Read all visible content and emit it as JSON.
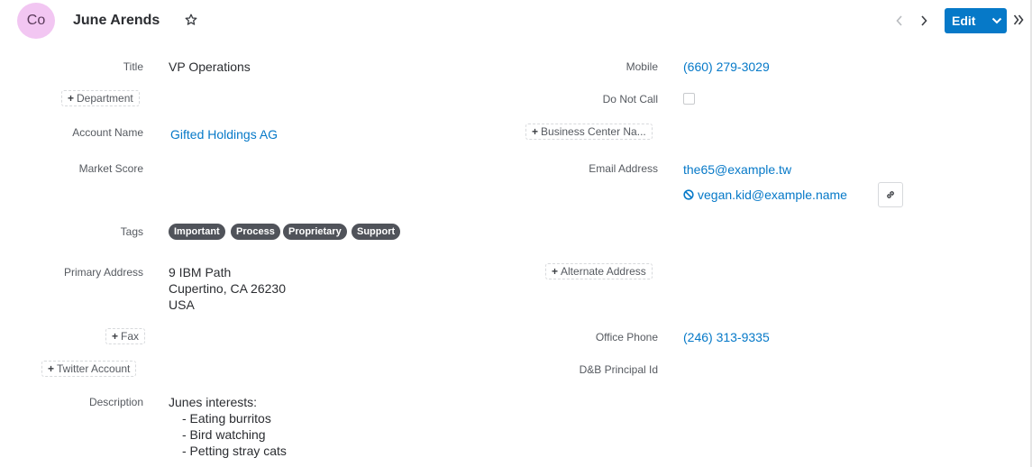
{
  "header": {
    "avatar_initials": "Co",
    "avatar_color": "#f2c6f2",
    "record_name": "June Arends",
    "edit_label": "Edit",
    "accent": "#0679c8",
    "icons": [
      "star-icon",
      "chevron-left-icon",
      "chevron-right-icon",
      "chevron-down-icon",
      "double-chevron-right-icon"
    ]
  },
  "fields": {
    "title": {
      "label": "Title",
      "value": "VP Operations"
    },
    "department": {
      "add_label": "Department"
    },
    "account_name": {
      "label": "Account Name",
      "value": "Gifted Holdings AG"
    },
    "market_score": {
      "label": "Market Score",
      "value": ""
    },
    "tags": {
      "label": "Tags",
      "items": [
        "Important",
        "Process",
        "Proprietary",
        "Support"
      ]
    },
    "primary_address": {
      "label": "Primary Address",
      "line1": "9 IBM Path",
      "line2": "Cupertino, CA 26230",
      "line3": "USA"
    },
    "fax": {
      "add_label": "Fax"
    },
    "twitter": {
      "add_label": "Twitter Account"
    },
    "description": {
      "label": "Description",
      "heading": "Junes interests:",
      "items": [
        "- Eating burritos",
        "- Bird watching",
        "- Petting stray cats"
      ]
    },
    "mobile": {
      "label": "Mobile",
      "value": "(660) 279-3029"
    },
    "do_not_call": {
      "label": "Do Not Call",
      "checked": false
    },
    "business_center": {
      "add_label": "Business Center Na..."
    },
    "email": {
      "label": "Email Address",
      "primary": "the65@example.tw",
      "secondary": "vegan.kid@example.name"
    },
    "alternate_address": {
      "add_label": "Alternate Address"
    },
    "office_phone": {
      "label": "Office Phone",
      "value": "(246) 313-9335"
    },
    "dnb_principal": {
      "label": "D&B Principal Id",
      "value": ""
    }
  }
}
